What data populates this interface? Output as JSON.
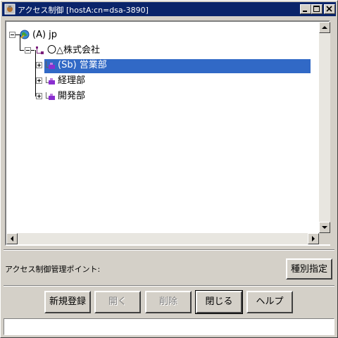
{
  "window": {
    "title": "アクセス制御 [hostA:cn=dsa-3890]",
    "minimize_symbol": "_",
    "maximize_symbol": "□",
    "close_symbol": "×"
  },
  "tree": {
    "nodes": [
      {
        "label": "(A) jp",
        "icon": "globe-icon",
        "expander": "minus",
        "level": 0
      },
      {
        "label": "〇△株式会社",
        "icon": "organization-icon",
        "expander": "minus",
        "level": 1
      },
      {
        "label": "(Sb) 営業部",
        "icon": "org-unit-icon",
        "expander": "plus",
        "level": 2,
        "selected": true
      },
      {
        "label": "経理部",
        "icon": "org-unit-icon",
        "expander": "plus",
        "level": 2
      },
      {
        "label": "開発部",
        "icon": "org-unit-icon",
        "expander": "plus",
        "level": 2
      }
    ]
  },
  "access_control_point": {
    "label": "アクセス制御管理ポイント:"
  },
  "buttons": {
    "type_specify": "種別指定",
    "new_register": "新規登録",
    "open": "開く",
    "delete": "削除",
    "close": "閉じる",
    "help": "ヘルプ"
  },
  "status_bar": {
    "text": ""
  },
  "colors": {
    "titlebar": "#0a246a",
    "selection": "#3169c6",
    "window_bg": "#d4d0c8"
  }
}
